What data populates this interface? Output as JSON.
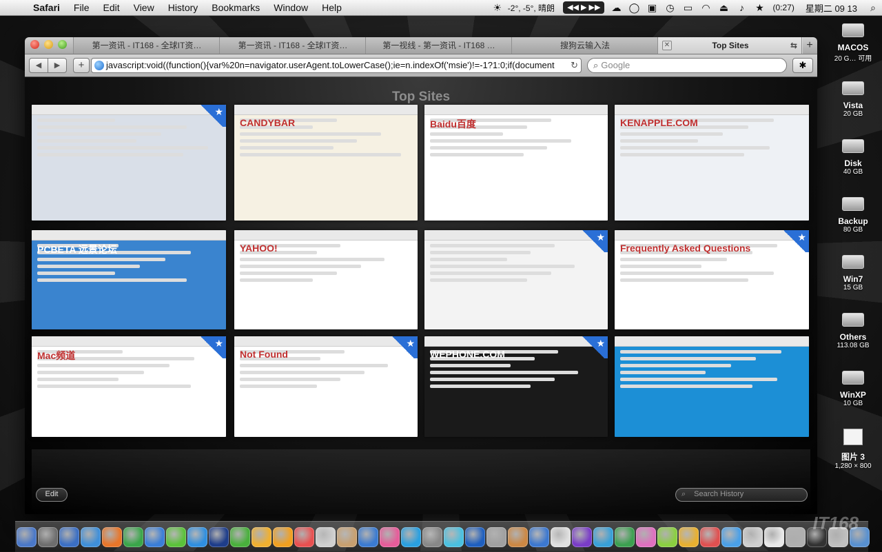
{
  "menubar": {
    "apple": "",
    "app_name": "Safari",
    "items": [
      "File",
      "Edit",
      "View",
      "History",
      "Bookmarks",
      "Window",
      "Help"
    ],
    "weather": "-2°, -5°, 晴朗",
    "media_controls": "◀◀ ▶ ▶▶",
    "battery": "(0:27)",
    "clock": "星期二 09 13"
  },
  "window": {
    "tabs": [
      {
        "label": "第一资讯 - IT168 - 全球IT资…"
      },
      {
        "label": "第一资讯 - IT168 - 全球IT资…"
      },
      {
        "label": "第一视线 - 第一资讯 - IT168 …"
      },
      {
        "label": "搜狗云输入法"
      },
      {
        "label": "Top Sites",
        "active": true
      }
    ],
    "tab_close_glyph": "✕",
    "tab_overflow_glyph": "⇆",
    "new_tab_glyph": "+",
    "back_glyph": "◀",
    "forward_glyph": "▶",
    "add_bookmark_glyph": "+",
    "url": "javascript:void((function(){var%20n=navigator.userAgent.toLowerCase();ie=n.indexOf('msie')!=-1?1:0;if(document",
    "reload_glyph": "↻",
    "search_placeholder": "Google",
    "search_glyph": "⌕",
    "bug_glyph": "✱"
  },
  "topsites": {
    "title": "Top Sites",
    "thumbnails": [
      {
        "label": "",
        "starred": true,
        "accent": "#d9dfe8"
      },
      {
        "label": "CANDYBAR",
        "starred": false,
        "accent": "#f6f1e3"
      },
      {
        "label": "Baidu百度",
        "starred": false,
        "accent": "#ffffff"
      },
      {
        "label": "KENAPPLE.COM",
        "starred": false,
        "accent": "#eef1f5"
      },
      {
        "label": "PCBETA 远景论坛",
        "starred": false,
        "accent": "#3a84cf"
      },
      {
        "label": "YAHOO!",
        "starred": false,
        "accent": "#ffffff"
      },
      {
        "label": "",
        "starred": true,
        "accent": "#f3f3f3"
      },
      {
        "label": "Frequently Asked Questions",
        "starred": true,
        "accent": "#ffffff"
      },
      {
        "label": "Mac频道",
        "starred": true,
        "accent": "#ffffff"
      },
      {
        "label": "Not Found",
        "starred": true,
        "accent": "#ffffff"
      },
      {
        "label": "WEPHONE.COM",
        "starred": true,
        "accent": "#1a1a1a"
      },
      {
        "label": "",
        "starred": false,
        "accent": "#1c8fd6"
      }
    ],
    "star_glyph": "★",
    "edit_label": "Edit",
    "search_history_placeholder": "Search History"
  },
  "desktop_icons": [
    {
      "name": "MACOS",
      "size": "20 G… 可用"
    },
    {
      "name": "Vista",
      "size": "20 GB"
    },
    {
      "name": "Disk",
      "size": "40 GB"
    },
    {
      "name": "Backup",
      "size": "80 GB"
    },
    {
      "name": "Win7",
      "size": "15 GB"
    },
    {
      "name": "Others",
      "size": "113.08 GB"
    },
    {
      "name": "WinXP",
      "size": "10 GB"
    },
    {
      "name": "图片 3",
      "size": "1,280 × 800"
    }
  ],
  "dock_colors": [
    "#4a78c8",
    "#6e6e6e",
    "#3b6fc4",
    "#3f8fd9",
    "#e8762a",
    "#3aa64a",
    "#3a7ed8",
    "#5bc23a",
    "#2f8fe0",
    "#1e3d8a",
    "#49b03c",
    "#f0b030",
    "#f2a020",
    "#e85050",
    "#d0d0d0",
    "#c8a070",
    "#3b7bd1",
    "#e65c9a",
    "#2aa0e0",
    "#888888",
    "#4ac0e0",
    "#1e5fbf",
    "#a0a0a0",
    "#cc8844",
    "#3c78d0",
    "#e0e0e0",
    "#7a3cc8",
    "#38a0d8",
    "#3ca050",
    "#e070c0",
    "#8ad040",
    "#e8b030",
    "#e05050",
    "#4aa0e8",
    "#d0d0d0",
    "#e8e8e8",
    "#b0b0b0",
    "#333333",
    "#c0c0c0",
    "#5890d0"
  ],
  "watermark": "IT168"
}
